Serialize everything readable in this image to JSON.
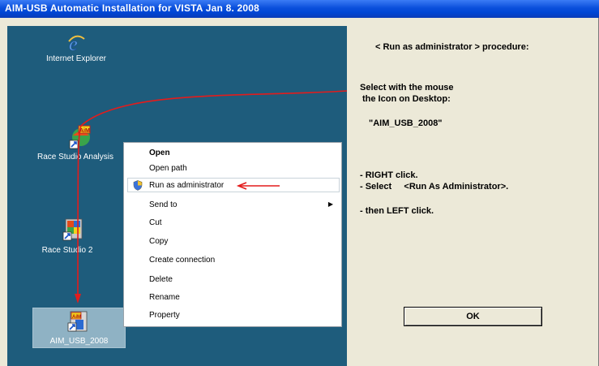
{
  "window": {
    "title": "AIM-USB Automatic Installation for VISTA   Jan 8. 2008"
  },
  "desktop": {
    "icons": [
      {
        "label": "Internet Explorer",
        "icon": "internet-explorer-icon"
      },
      {
        "label": "Race Studio Analysis",
        "icon": "race-studio-analysis-icon"
      },
      {
        "label": "Race Studio 2",
        "icon": "race-studio-2-icon"
      },
      {
        "label": "AIM_USB_2008",
        "icon": "aim-usb-icon"
      }
    ]
  },
  "context_menu": {
    "items": [
      {
        "label": "Open"
      },
      {
        "label": "Open path"
      },
      {
        "label": "Run as administrator",
        "icon": "shield-icon"
      },
      {
        "label": "Send to"
      },
      {
        "label": "Cut"
      },
      {
        "label": "Copy"
      },
      {
        "label": "Create connection"
      },
      {
        "label": "Delete"
      },
      {
        "label": "Rename"
      },
      {
        "label": "Property"
      }
    ]
  },
  "instructions": {
    "heading": "< Run as administrator > procedure:",
    "select_line1": "Select with the mouse",
    "select_line2": "the Icon on Desktop:",
    "filename": "\"AIM_USB_2008\"",
    "step1": "- RIGHT click.",
    "step2": "- Select     <Run As Administrator>.",
    "step3": "- then LEFT click."
  },
  "ok_button": {
    "label": "OK"
  },
  "colors": {
    "titlebar": "#0a4fdb",
    "desktop": "#1e5c7c",
    "panel": "#ece9d8",
    "arrow": "#e31c1c"
  }
}
